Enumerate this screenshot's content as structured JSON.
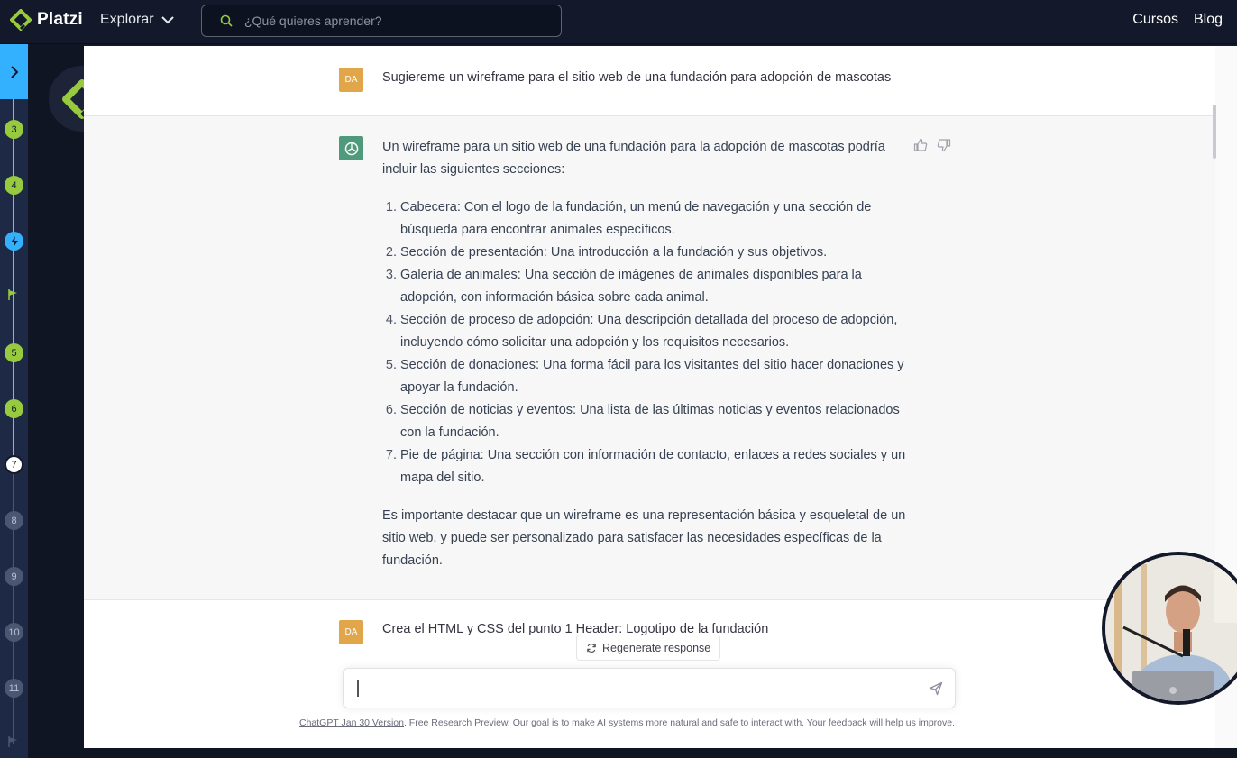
{
  "header": {
    "brand": "Platzi",
    "explore_label": "Explorar",
    "search_placeholder": "¿Qué quieres aprender?",
    "links": [
      "Cursos",
      "Blog"
    ]
  },
  "sidebar": {
    "nodes": [
      {
        "label": "3",
        "state": "done"
      },
      {
        "label": "4",
        "state": "done"
      },
      {
        "label": "",
        "state": "bolt"
      },
      {
        "label": "5",
        "state": "done"
      },
      {
        "label": "6",
        "state": "done"
      },
      {
        "label": "7",
        "state": "current"
      },
      {
        "label": "8",
        "state": "future"
      },
      {
        "label": "9",
        "state": "future"
      },
      {
        "label": "10",
        "state": "future"
      },
      {
        "label": "11",
        "state": "future"
      }
    ]
  },
  "chat": {
    "user_initials": "DA",
    "prompt_1": "Sugiereme un wireframe para el sitio web de una fundación para adopción de mascotas",
    "response_intro": "Un wireframe para un sitio web de una fundación para la adopción de mascotas podría incluir las siguientes secciones:",
    "response_items": [
      "Cabecera: Con el logo de la fundación, un menú de navegación y una sección de búsqueda para encontrar animales específicos.",
      "Sección de presentación: Una introducción a la fundación y sus objetivos.",
      "Galería de animales: Una sección de imágenes de animales disponibles para la adopción, con información básica sobre cada animal.",
      "Sección de proceso de adopción: Una descripción detallada del proceso de adopción, incluyendo cómo solicitar una adopción y los requisitos necesarios.",
      "Sección de donaciones: Una forma fácil para los visitantes del sitio hacer donaciones y apoyar la fundación.",
      "Sección de noticias y eventos: Una lista de las últimas noticias y eventos relacionados con la fundación.",
      "Pie de página: Una sección con información de contacto, enlaces a redes sociales y un mapa del sitio."
    ],
    "response_outro": "Es importante destacar que un wireframe es una representación básica y esqueletal de un sitio web, y puede ser personalizado para satisfacer las necesidades específicas de la fundación.",
    "prompt_2": "Crea el HTML y CSS del punto 1 Header: Logotipo de la fundación",
    "regenerate_label": "Regenerate response",
    "input_value": "",
    "footer_link": "ChatGPT Jan 30 Version",
    "footer_text": ". Free Research Preview. Our goal is to make AI systems more natural and safe to interact with. Your feedback will help us improve."
  },
  "colors": {
    "platzi_green": "#98ca3f",
    "platzi_navy": "#13192a",
    "accent_blue": "#33b1ff",
    "user_avatar": "#e1a64a",
    "gpt_avatar": "#4f9a7c"
  }
}
